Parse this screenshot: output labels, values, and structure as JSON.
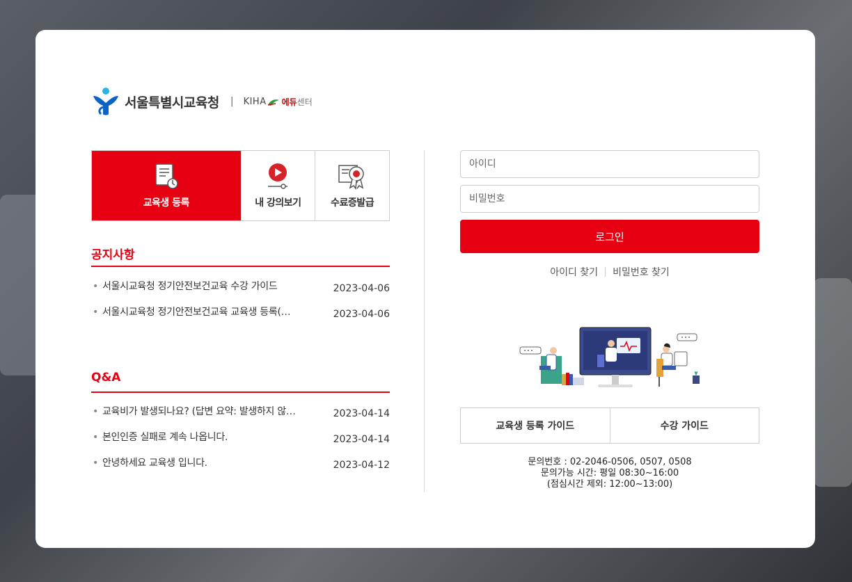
{
  "header": {
    "org_name": "서울특별시교육청",
    "separator": "|",
    "partner_logo": "KIHA",
    "partner_name": "에듀",
    "partner_suffix": "센터"
  },
  "tabs": [
    {
      "label": "교육생 등록",
      "icon": "document-icon",
      "active": true
    },
    {
      "label": "내 강의보기",
      "icon": "play-icon",
      "active": false
    },
    {
      "label": "수료증발급",
      "icon": "certificate-icon",
      "active": false
    }
  ],
  "notice": {
    "title": "공지사항",
    "items": [
      {
        "text": "서울시교육청 정기안전보건교육 수강 가이드",
        "date": "2023-04-06"
      },
      {
        "text": "서울시교육청 정기안전보건교육 교육생 등록(…",
        "date": "2023-04-06"
      }
    ]
  },
  "qna": {
    "title": "Q&A",
    "items": [
      {
        "text": "교육비가 발생되나요? (답변 요약: 발생하지 않…",
        "date": "2023-04-14"
      },
      {
        "text": "본인인증 실패로 계속 나옵니다.",
        "date": "2023-04-14"
      },
      {
        "text": "안녕하세요 교육생 입니다.",
        "date": "2023-04-12"
      }
    ]
  },
  "login": {
    "id_placeholder": "아이디",
    "pw_placeholder": "비밀번호",
    "button": "로그인",
    "find_id": "아이디 찾기",
    "find_pw": "비밀번호 찾기"
  },
  "guides": {
    "register": "교육생 등록 가이드",
    "course": "수강 가이드"
  },
  "contact": {
    "phone": "문의번호 : 02-2046-0506, 0507, 0508",
    "hours": "문의가능 시간: 평일 08:30~16:00",
    "lunch": "(점심시간 제외: 12:00~13:00)"
  },
  "colors": {
    "accent": "#e60012",
    "logo_blue": "#0b63c5"
  }
}
